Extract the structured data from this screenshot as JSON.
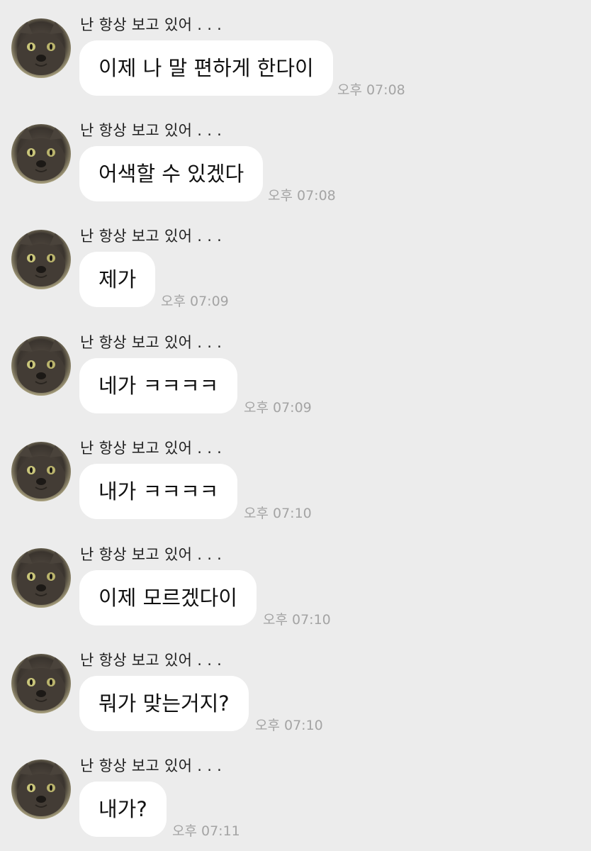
{
  "sender_name": "난 항상 보고 있어 . . .",
  "messages": [
    {
      "text": "이제 나 말 편하게 한다이",
      "time": "오후 07:08"
    },
    {
      "text": "어색할 수 있겠다",
      "time": "오후 07:08"
    },
    {
      "text": "제가",
      "time": "오후 07:09"
    },
    {
      "text": "네가 ㅋㅋㅋㅋ",
      "time": "오후 07:09"
    },
    {
      "text": "내가 ㅋㅋㅋㅋ",
      "time": "오후 07:10"
    },
    {
      "text": "이제 모르겠다이",
      "time": "오후 07:10"
    },
    {
      "text": "뭐가 맞는거지?",
      "time": "오후 07:10"
    },
    {
      "text": "내가?",
      "time": "오후 07:11"
    }
  ],
  "avatar_icon": "cat-photo-icon",
  "colors": {
    "background": "#ececec",
    "bubble": "#ffffff",
    "timestamp": "#a4a4a4",
    "text": "#111111"
  }
}
